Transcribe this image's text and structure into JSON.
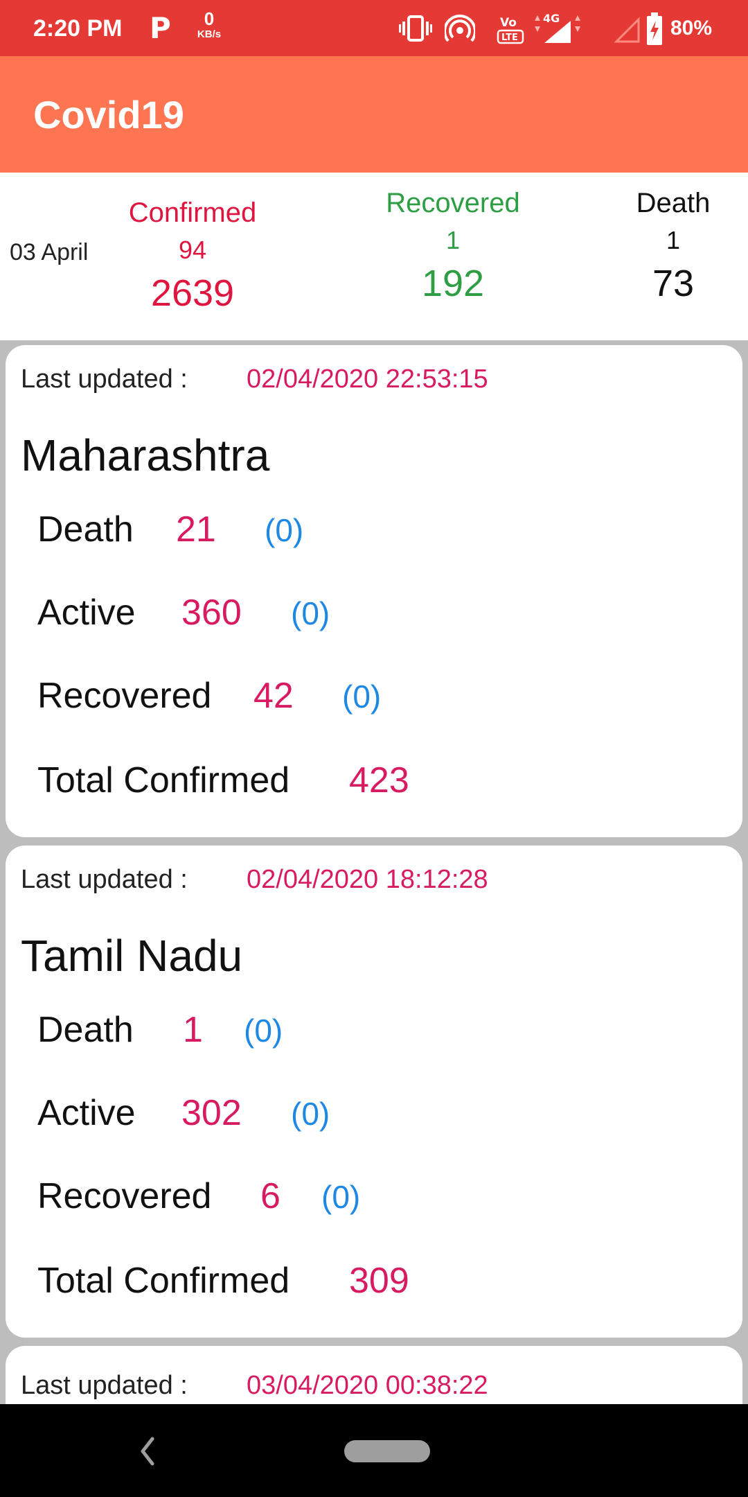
{
  "status_bar": {
    "time": "2:20 PM",
    "p_icon": "P",
    "net_speed_value": "0",
    "net_speed_unit": "KB/s",
    "icons": [
      "vibrate-icon",
      "hotspot-icon",
      "volte-icon",
      "signal-4g-icon",
      "signal-empty-icon",
      "battery-charging-icon"
    ],
    "battery": "80%"
  },
  "app_bar": {
    "title": "Covid19"
  },
  "summary": {
    "date": "03 April",
    "confirmed": {
      "label": "Confirmed",
      "delta": "94",
      "total": "2639"
    },
    "recovered": {
      "label": "Recovered",
      "delta": "1",
      "total": "192"
    },
    "death": {
      "label": "Death",
      "delta": "1",
      "total": "73"
    }
  },
  "cards": [
    {
      "last_updated_label": "Last updated :",
      "timestamp": "02/04/2020 22:53:15",
      "state": "Maharashtra",
      "death": {
        "label": "Death",
        "value": "21",
        "change": "(0)"
      },
      "active": {
        "label": "Active",
        "value": "360",
        "change": "(0)"
      },
      "recovered": {
        "label": "Recovered",
        "value": "42",
        "change": "(0)"
      },
      "total_confirmed": {
        "label": "Total Confirmed",
        "value": "423"
      }
    },
    {
      "last_updated_label": "Last updated :",
      "timestamp": "02/04/2020 18:12:28",
      "state": "Tamil Nadu",
      "death": {
        "label": "Death",
        "value": "1",
        "change": "(0)"
      },
      "active": {
        "label": "Active",
        "value": "302",
        "change": "(0)"
      },
      "recovered": {
        "label": "Recovered",
        "value": "6",
        "change": "(0)"
      },
      "total_confirmed": {
        "label": "Total Confirmed",
        "value": "309"
      }
    },
    {
      "last_updated_label": "Last updated :",
      "timestamp": "03/04/2020 00:38:22"
    }
  ],
  "nav_bar": {
    "icons": [
      "back-icon",
      "home-pill-icon"
    ]
  },
  "colors": {
    "status_bar": "#e53935",
    "app_bar": "#ff7551",
    "confirmed": "#e0153f",
    "recovered": "#2e9e45",
    "value": "#d81b60",
    "change": "#1e88e5"
  }
}
